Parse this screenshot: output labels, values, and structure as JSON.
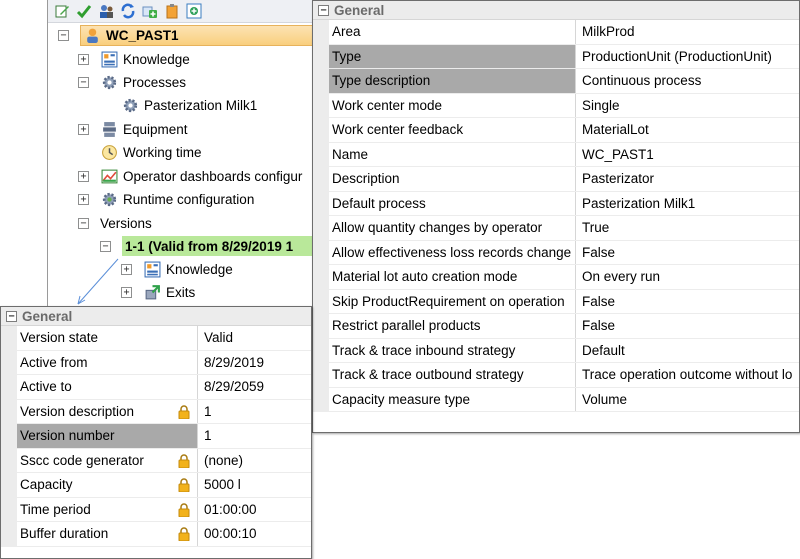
{
  "tree": {
    "root": "WC_PAST1",
    "items": [
      {
        "label": "Knowledge",
        "icon": "knowledge-icon",
        "expander": "+"
      },
      {
        "label": "Processes",
        "icon": "gear-icon",
        "expander": "−"
      },
      {
        "label": "Pasterization Milk1",
        "icon": "gear-icon"
      },
      {
        "label": "Equipment",
        "icon": "equipment-icon",
        "expander": "+"
      },
      {
        "label": "Working time",
        "icon": "clock-icon"
      },
      {
        "label": "Operator dashboards configur",
        "icon": "dashboard-icon",
        "expander": "+"
      },
      {
        "label": "Runtime configuration",
        "icon": "gear-icon",
        "expander": "+"
      },
      {
        "label": "Versions",
        "expander": "−"
      },
      {
        "label": "1-1 (Valid from 8/29/2019 1",
        "expander": "−"
      },
      {
        "label": "Knowledge",
        "icon": "knowledge-icon",
        "expander": "+"
      },
      {
        "label": "Exits",
        "icon": "exits-icon",
        "expander": "+"
      }
    ]
  },
  "right_grid": {
    "header": "General",
    "rows": [
      {
        "name": "Area",
        "value": "MilkProd"
      },
      {
        "name": "Type",
        "value": "ProductionUnit (ProductionUnit)"
      },
      {
        "name": "Type description",
        "value": "Continuous process"
      },
      {
        "name": "Work center mode",
        "value": "Single"
      },
      {
        "name": "Work center feedback",
        "value": "MaterialLot"
      },
      {
        "name": "Name",
        "value": "WC_PAST1"
      },
      {
        "name": "Description",
        "value": "Pasterizator"
      },
      {
        "name": "Default process",
        "value": "Pasterization Milk1"
      },
      {
        "name": "Allow quantity changes by operator",
        "value": "True"
      },
      {
        "name": "Allow effectiveness loss records change",
        "value": "False"
      },
      {
        "name": "Material lot auto creation mode",
        "value": "On every run"
      },
      {
        "name": "Skip ProductRequirement on operation",
        "value": "False"
      },
      {
        "name": "Restrict parallel products",
        "value": "False"
      },
      {
        "name": "Track & trace inbound strategy",
        "value": "Default"
      },
      {
        "name": "Track & trace outbound strategy",
        "value": "Trace operation outcome without lo"
      },
      {
        "name": "Capacity measure type",
        "value": "Volume"
      }
    ]
  },
  "left_grid": {
    "header": "General",
    "rows": [
      {
        "name": "Version state",
        "value": "Valid"
      },
      {
        "name": "Active from",
        "value": "8/29/2019"
      },
      {
        "name": "Active to",
        "value": "8/29/2059"
      },
      {
        "name": "Version description",
        "value": "1"
      },
      {
        "name": "Version number",
        "value": "1"
      },
      {
        "name": "Sscc code generator",
        "value": "(none)"
      },
      {
        "name": "Capacity",
        "value": "5000 l"
      },
      {
        "name": "Time period",
        "value": "01:00:00"
      },
      {
        "name": "Buffer duration",
        "value": "00:00:10"
      }
    ]
  },
  "colors": {
    "selected_root": "#f9cf7e",
    "selected_version": "#b9e89a",
    "selected_property": "#a9a9a9",
    "lock": "#f2b21b",
    "connector": "#5b8fd8"
  }
}
